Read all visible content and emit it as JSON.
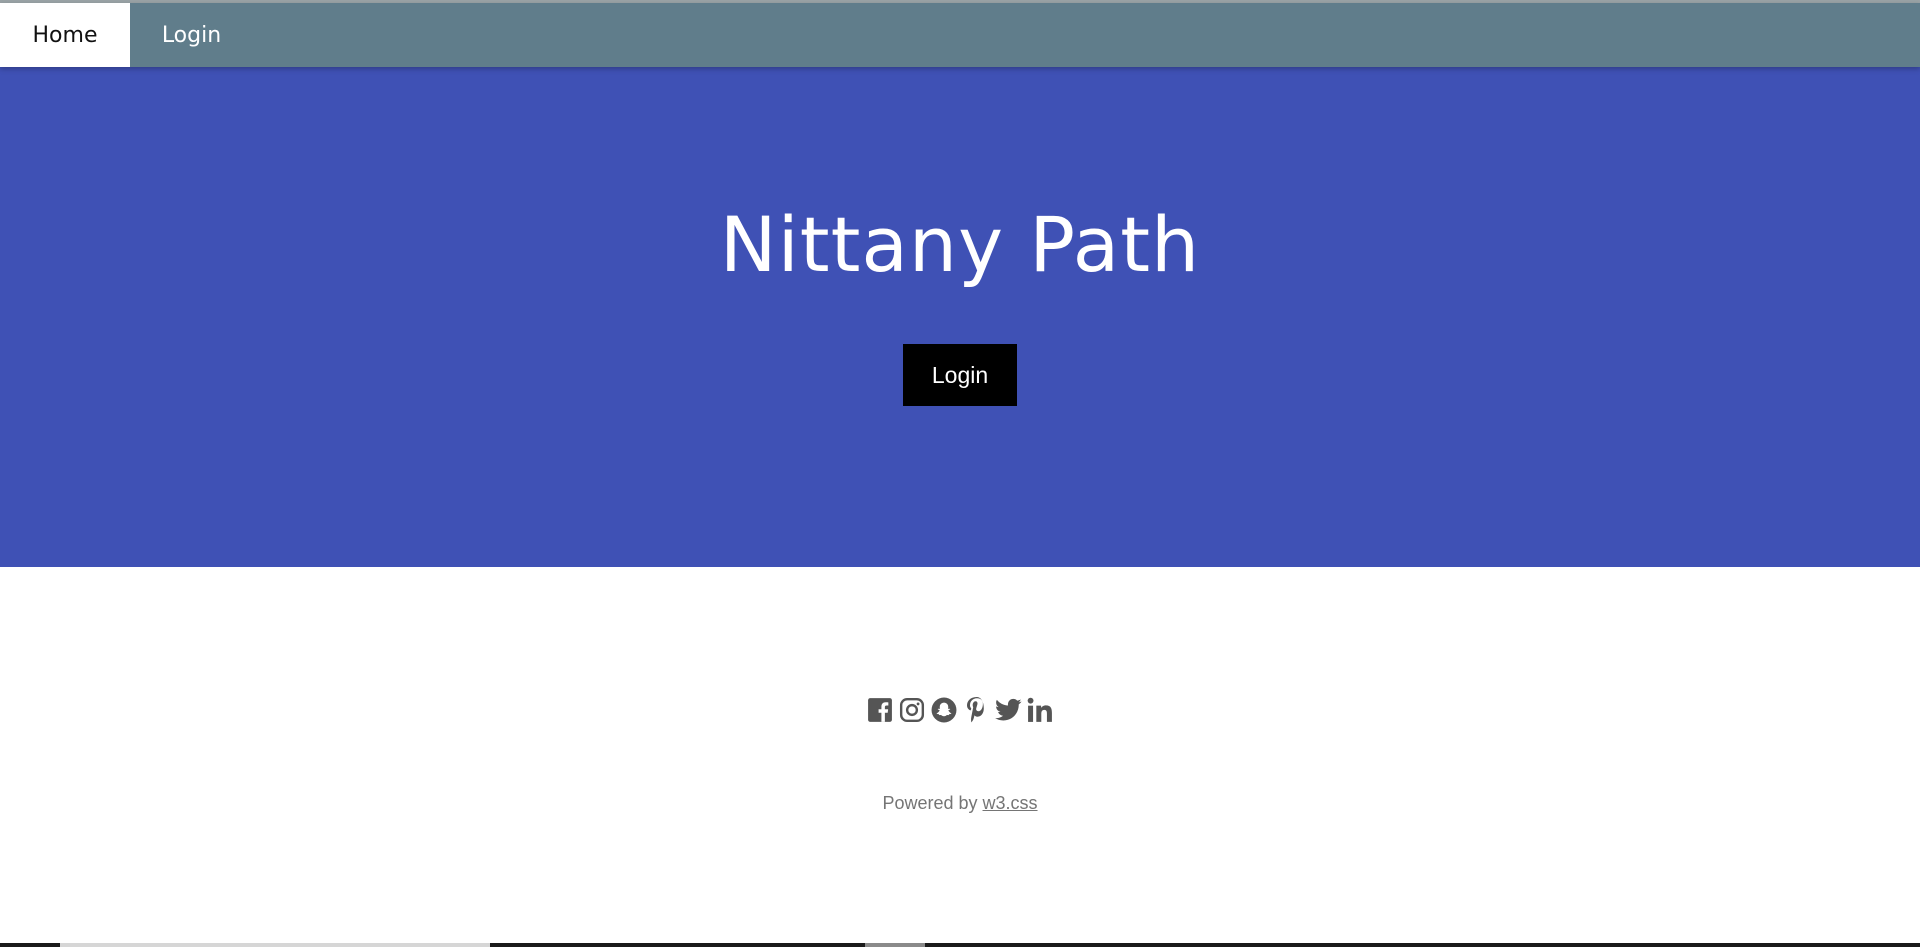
{
  "nav": {
    "home_label": "Home",
    "login_label": "Login"
  },
  "hero": {
    "title": "Nittany Path",
    "login_button": "Login"
  },
  "footer": {
    "social_icons": [
      "facebook-icon",
      "instagram-icon",
      "snapchat-icon",
      "pinterest-icon",
      "twitter-icon",
      "linkedin-icon"
    ],
    "powered_prefix": "Powered by ",
    "powered_link": "w3.css"
  },
  "colors": {
    "navbar": "#607d8b",
    "hero": "#3f51b5",
    "button": "#000000",
    "icon": "#555555",
    "footer_text": "#757575"
  }
}
